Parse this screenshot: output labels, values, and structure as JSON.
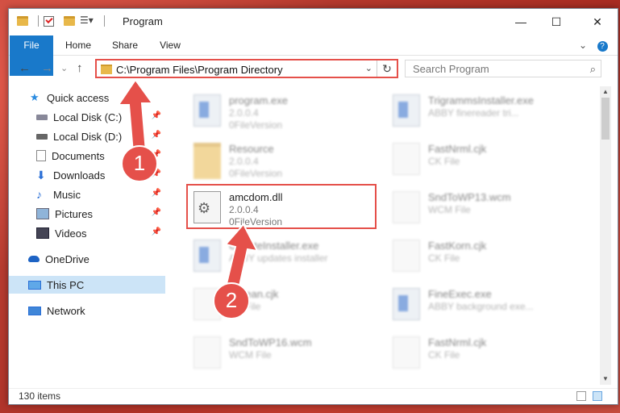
{
  "window": {
    "title": "Program",
    "minimize": "—",
    "maximize": "☐",
    "close": "✕"
  },
  "ribbon": {
    "tabs": [
      "File",
      "Home",
      "Share",
      "View"
    ],
    "collapse": "⌄",
    "help": "?"
  },
  "address": {
    "path": "C:\\Program Files\\Program Directory",
    "dropdown": "⌄",
    "refresh": "↻"
  },
  "search": {
    "placeholder": "Search Program"
  },
  "nav": {
    "back": "←",
    "forward": "→",
    "recent": "⌄",
    "up": "↑"
  },
  "sidebar": {
    "items": [
      {
        "label": "Quick access",
        "icon": "star-icon",
        "pinned": false
      },
      {
        "label": "Local Disk (C:)",
        "icon": "drive-icon",
        "pinned": true
      },
      {
        "label": "Local Disk (D:)",
        "icon": "drive-icon",
        "pinned": true
      },
      {
        "label": "Documents",
        "icon": "documents-icon",
        "pinned": true
      },
      {
        "label": "Downloads",
        "icon": "downloads-icon",
        "pinned": true
      },
      {
        "label": "Music",
        "icon": "music-icon",
        "pinned": true
      },
      {
        "label": "Pictures",
        "icon": "pictures-icon",
        "pinned": true
      },
      {
        "label": "Videos",
        "icon": "videos-icon",
        "pinned": true
      },
      {
        "label": "OneDrive",
        "icon": "cloud-icon",
        "pinned": false
      },
      {
        "label": "This PC",
        "icon": "computer-icon",
        "pinned": false
      },
      {
        "label": "Network",
        "icon": "network-icon",
        "pinned": false
      }
    ]
  },
  "files": [
    {
      "name": "program.exe",
      "line2": "2.0.0.4",
      "line3": "0FileVersion",
      "icon": "exe-icon"
    },
    {
      "name": "TrigrammsInstaller.exe",
      "line2": "ABBY finereader tri...",
      "line3": "",
      "icon": "app-icon"
    },
    {
      "name": "Resource",
      "line2": "2.0.0.4",
      "line3": "0FileVersion",
      "icon": "folder-icon"
    },
    {
      "name": "FastNrml.cjk",
      "line2": "CK File",
      "line3": "",
      "icon": "file-icon"
    },
    {
      "name": "amcdom.dll",
      "line2": "2.0.0.4",
      "line3": "0FileVersion",
      "icon": "dll-gear-icon"
    },
    {
      "name": "SndToWP13.wcm",
      "line2": "WCM File",
      "line3": "",
      "icon": "file-icon"
    },
    {
      "name": "UpdateInstaller.exe",
      "line2": "ABBY updates installer",
      "line3": "",
      "icon": "app-icon"
    },
    {
      "name": "FastKorn.cjk",
      "line2": "CK File",
      "line3": "",
      "icon": "file-icon"
    },
    {
      "name": "Korean.cjk",
      "line2": "CK File",
      "line3": "",
      "icon": "file-icon"
    },
    {
      "name": "FineExec.exe",
      "line2": "ABBY background exe...",
      "line3": "",
      "icon": "app-icon"
    },
    {
      "name": "SndToWP16.wcm",
      "line2": "WCM File",
      "line3": "",
      "icon": "file-icon"
    },
    {
      "name": "FastNrml.cjk",
      "line2": "CK File",
      "line3": "",
      "icon": "file-icon"
    }
  ],
  "status": {
    "count": "130 items"
  },
  "callouts": {
    "one": "1",
    "two": "2"
  },
  "colors": {
    "accent": "#1979ca",
    "highlight": "#e5504a",
    "selection": "#cce4f7"
  }
}
